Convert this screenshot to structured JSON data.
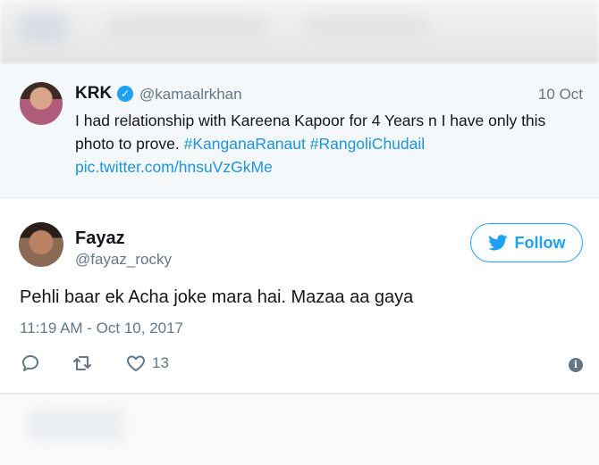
{
  "quoted_tweet": {
    "name": "KRK",
    "verified_icon": "verified-badge-icon",
    "handle": "@kamaalrkhan",
    "date": "10 Oct",
    "text_plain": "I had relationship with Kareena Kapoor for 4 Years n I have only this photo to prove. ",
    "hashtag_1": "#KanganaRanaut",
    "hashtag_2": "#RangoliChudail",
    "link": "pic.twitter.com/hnsuVzGkMe"
  },
  "reply_tweet": {
    "name": "Fayaz",
    "handle": "@fayaz_rocky",
    "follow_label": "Follow",
    "text": "Pehli baar ek Acha joke mara hai. Mazaa aa gaya",
    "timestamp": "11:19 AM - Oct 10, 2017",
    "actions": {
      "reply_icon": "reply-icon",
      "retweet_icon": "retweet-icon",
      "like_icon": "heart-icon",
      "like_count": "13",
      "info_icon": "info-icon"
    }
  },
  "colors": {
    "accent": "#1da1f2",
    "link": "#1b95e0",
    "secondary_text": "#657786",
    "quoted_bg": "#f5f8fa"
  }
}
